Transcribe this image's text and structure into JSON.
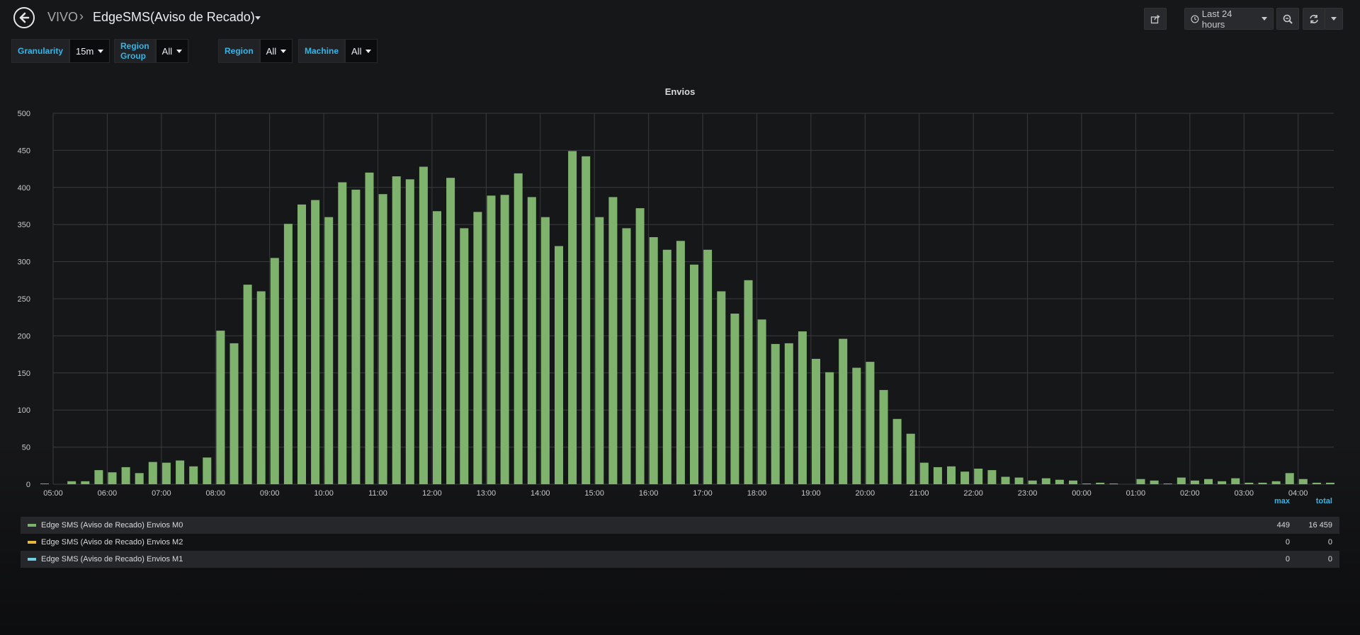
{
  "nav": {
    "folder": "VIVO",
    "title": "EdgeSMS(Aviso de Recado)",
    "time_range": "Last 24 hours"
  },
  "variables": [
    {
      "label": "Granularity",
      "value": "15m"
    },
    {
      "label": "Region Group",
      "value": "All"
    },
    {
      "label": "Region",
      "value": "All"
    },
    {
      "label": "Machine",
      "value": "All"
    }
  ],
  "panel": {
    "title": "Envios"
  },
  "colors": {
    "series_m0": "#7eb26d",
    "series_m2": "#eab839",
    "series_m1": "#6ed0e0",
    "accent": "#33b5e5"
  },
  "legend": {
    "max_header": "max",
    "total_header": "total",
    "items": [
      {
        "name": "Edge SMS (Aviso de Recado) Envios M0",
        "max": "449",
        "total": "16 459"
      },
      {
        "name": "Edge SMS (Aviso de Recado) Envios M2",
        "max": "0",
        "total": "0"
      },
      {
        "name": "Edge SMS (Aviso de Recado) Envios M1",
        "max": "0",
        "total": "0"
      }
    ]
  },
  "chart_data": {
    "type": "bar",
    "title": "Envios",
    "ylim": [
      0,
      500
    ],
    "yticks": [
      0,
      50,
      100,
      150,
      200,
      250,
      300,
      350,
      400,
      450,
      500
    ],
    "xticks": [
      "05:00",
      "06:00",
      "07:00",
      "08:00",
      "09:00",
      "10:00",
      "11:00",
      "12:00",
      "13:00",
      "14:00",
      "15:00",
      "16:00",
      "17:00",
      "18:00",
      "19:00",
      "20:00",
      "21:00",
      "22:00",
      "23:00",
      "00:00",
      "01:00",
      "02:00",
      "03:00",
      "04:00"
    ],
    "grid": true,
    "bar_interval": "15m",
    "series": [
      {
        "name": "Edge SMS (Aviso de Recado) Envios M0",
        "values": [
          1,
          0,
          4,
          4,
          19,
          16,
          23,
          15,
          30,
          29,
          32,
          24,
          36,
          207,
          190,
          269,
          260,
          305,
          351,
          377,
          383,
          360,
          407,
          397,
          420,
          391,
          415,
          411,
          428,
          368,
          413,
          345,
          367,
          389,
          390,
          419,
          387,
          360,
          321,
          449,
          442,
          360,
          387,
          345,
          372,
          333,
          316,
          328,
          296,
          316,
          260,
          230,
          275,
          222,
          189,
          190,
          206,
          169,
          151,
          196,
          157,
          165,
          127,
          88,
          68,
          29,
          23,
          24,
          17,
          21,
          19,
          10,
          9,
          5,
          8,
          6,
          5,
          1,
          2,
          1,
          0,
          7,
          5,
          1,
          9,
          5,
          7,
          4,
          8,
          2,
          2,
          4,
          15,
          7,
          2,
          2
        ]
      },
      {
        "name": "Edge SMS (Aviso de Recado) Envios M2",
        "values": []
      },
      {
        "name": "Edge SMS (Aviso de Recado) Envios M1",
        "values": []
      }
    ]
  }
}
